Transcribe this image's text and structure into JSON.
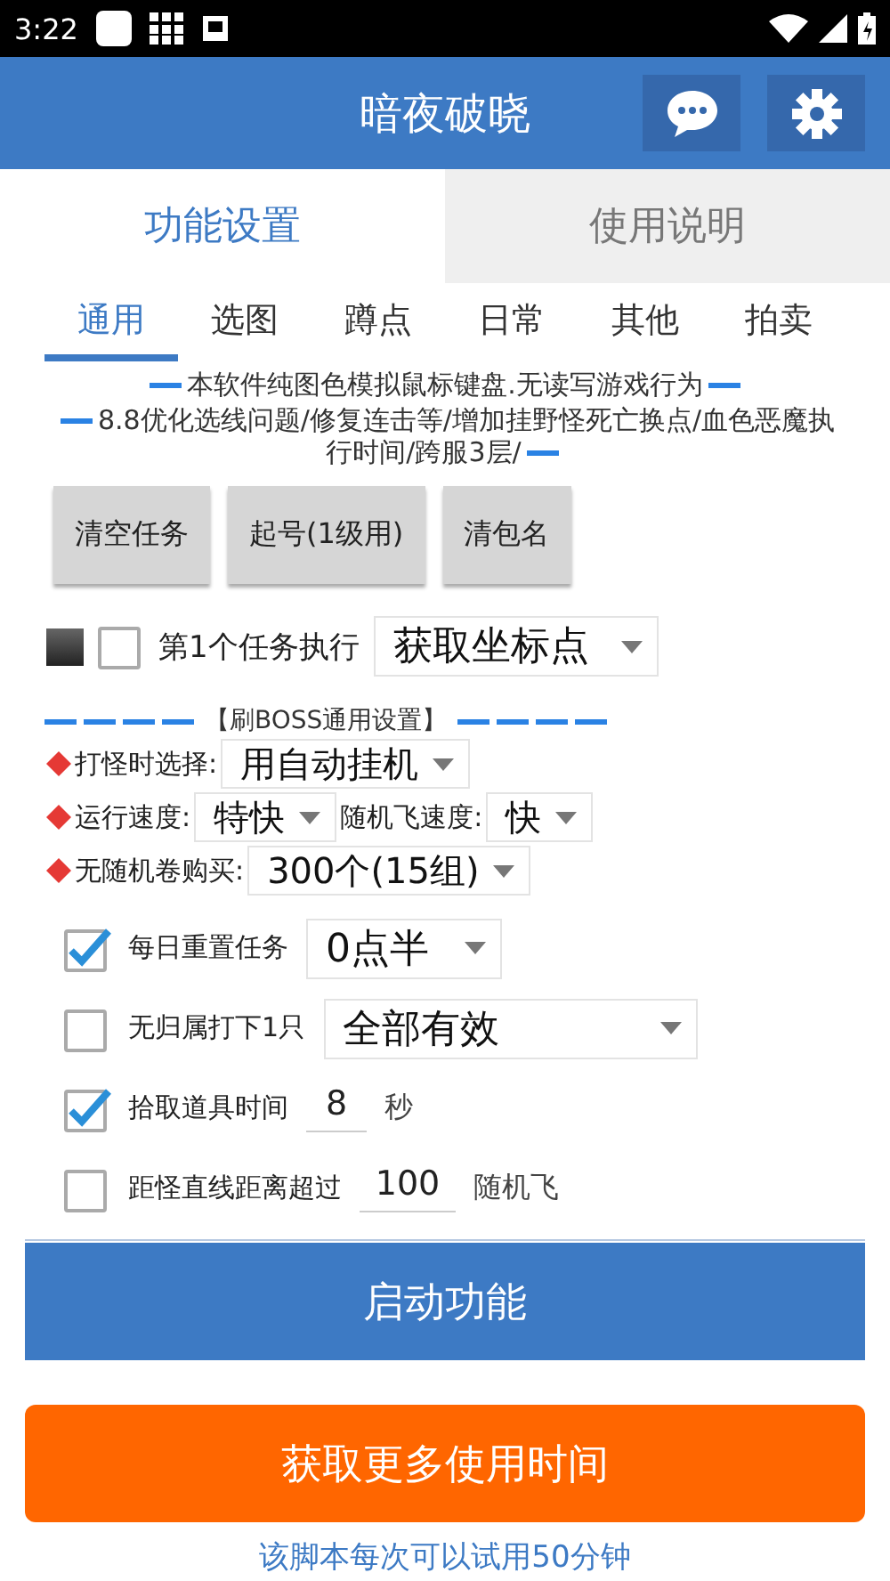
{
  "status_bar": {
    "time": "3:22"
  },
  "header": {
    "title": "暗夜破晓"
  },
  "main_tabs": [
    {
      "label": "功能设置",
      "selected": true
    },
    {
      "label": "使用说明",
      "selected": false
    }
  ],
  "sub_tabs": [
    {
      "label": "通用",
      "selected": true
    },
    {
      "label": "选图",
      "selected": false
    },
    {
      "label": "蹲点",
      "selected": false
    },
    {
      "label": "日常",
      "selected": false
    },
    {
      "label": "其他",
      "selected": false
    },
    {
      "label": "拍卖",
      "selected": false
    }
  ],
  "notices": [
    "本软件纯图色模拟鼠标键盘.无读写游戏行为",
    "8.8优化选线问题/修复连击等/增加挂野怪死亡换点/血色恶魔执行时间/跨服3层/"
  ],
  "action_buttons": [
    "清空任务",
    "起号(1级用)",
    "清包名"
  ],
  "task_row": {
    "checked": false,
    "label": "第1个任务执行",
    "value": "获取坐标点"
  },
  "section_title": "【刷BOSS通用设置】",
  "boss_settings": [
    {
      "label": "打怪时选择:",
      "value": "用自动挂机"
    },
    {
      "label": "运行速度:",
      "value": "特快",
      "extra_label": "随机飞速度:",
      "extra_value": "快"
    },
    {
      "label": "无随机卷购买:",
      "value": "300个(15组)"
    }
  ],
  "options": [
    {
      "kind": "select",
      "checked": true,
      "label": "每日重置任务",
      "value": "0点半"
    },
    {
      "kind": "select",
      "checked": false,
      "label": "无归属打下1只",
      "value": "全部有效"
    },
    {
      "kind": "number",
      "checked": true,
      "label": "拾取道具时间",
      "value": "8",
      "unit": "秒"
    },
    {
      "kind": "number",
      "checked": false,
      "label": "距怪直线距离超过",
      "value": "100",
      "unit": "随机飞"
    }
  ],
  "start_button": "启动功能",
  "more_time_button": "获取更多使用时间",
  "footer_note": "该脚本每次可以试用50分钟"
}
